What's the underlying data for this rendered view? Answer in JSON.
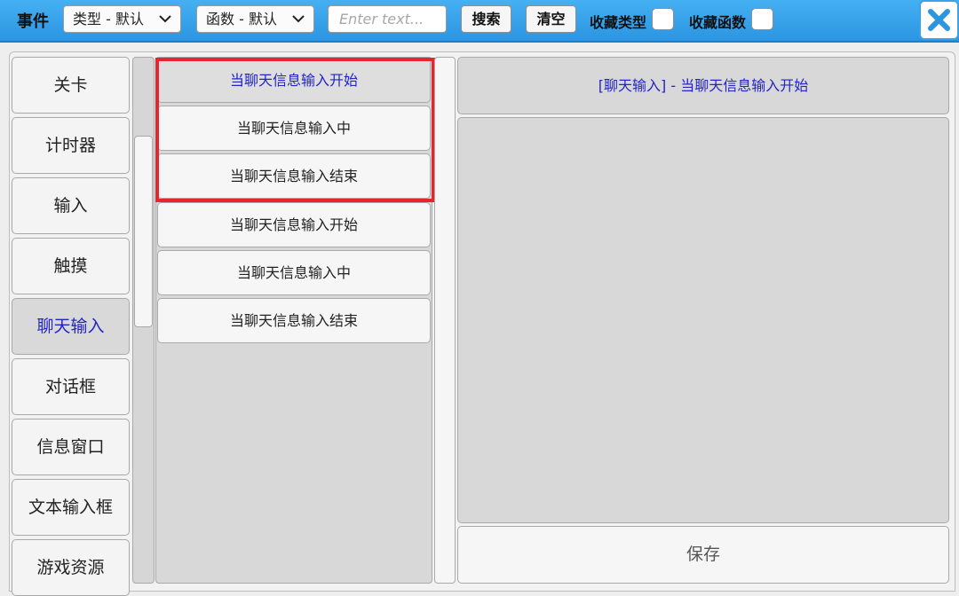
{
  "header": {
    "title": "事件",
    "type_dropdown": "类型 - 默认",
    "func_dropdown": "函数 - 默认",
    "search_placeholder": "Enter text...",
    "search_label": "搜索",
    "clear_label": "清空",
    "fav_type_label": "收藏类型",
    "fav_func_label": "收藏函数",
    "fav_type_checked": false,
    "fav_func_checked": false
  },
  "categories": [
    {
      "label": "关卡",
      "active": false
    },
    {
      "label": "计时器",
      "active": false
    },
    {
      "label": "输入",
      "active": false
    },
    {
      "label": "触摸",
      "active": false
    },
    {
      "label": "聊天输入",
      "active": true
    },
    {
      "label": "对话框",
      "active": false
    },
    {
      "label": "信息窗口",
      "active": false
    },
    {
      "label": "文本输入框",
      "active": false
    },
    {
      "label": "游戏资源",
      "active": false
    }
  ],
  "functions": [
    {
      "label": "当聊天信息输入开始",
      "active": true
    },
    {
      "label": "当聊天信息输入中",
      "active": false
    },
    {
      "label": "当聊天信息输入结束",
      "active": false
    },
    {
      "label": "当聊天信息输入开始",
      "active": false
    },
    {
      "label": "当聊天信息输入中",
      "active": false
    },
    {
      "label": "当聊天信息输入结束",
      "active": false
    }
  ],
  "detail": {
    "title": "[聊天输入] - 当聊天信息输入开始",
    "save_label": "保存"
  },
  "colors": {
    "header_blue": "#2b95e2",
    "active_text": "#2323c8",
    "highlight_red": "#e8242c"
  }
}
